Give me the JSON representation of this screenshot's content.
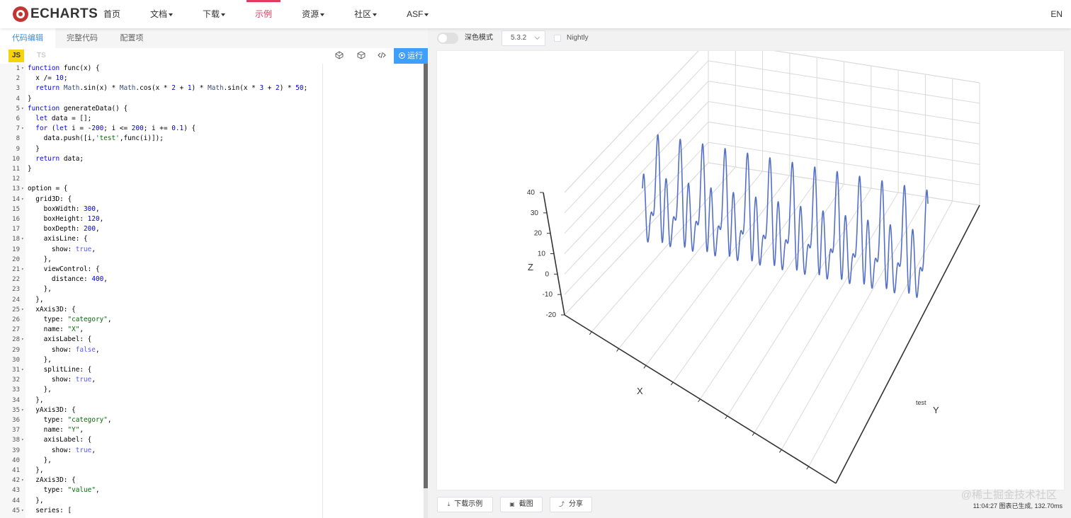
{
  "nav": {
    "logo_text": "ECHARTS",
    "items": [
      {
        "label": "首页",
        "dropdown": false,
        "active": false
      },
      {
        "label": "文档",
        "dropdown": true,
        "active": false
      },
      {
        "label": "下载",
        "dropdown": true,
        "active": false
      },
      {
        "label": "示例",
        "dropdown": false,
        "active": true
      },
      {
        "label": "资源",
        "dropdown": true,
        "active": false
      },
      {
        "label": "社区",
        "dropdown": true,
        "active": false
      },
      {
        "label": "ASF",
        "dropdown": true,
        "active": false
      }
    ],
    "lang": "EN",
    "accent": "#e43961"
  },
  "editor": {
    "tabs": [
      "代码编辑",
      "完整代码",
      "配置项"
    ],
    "active_tab": 0,
    "lang_js": "JS",
    "lang_ts": "TS",
    "tool_icons": [
      "codepen-icon",
      "codesandbox-icon",
      "code-icon"
    ],
    "run_label": "运行",
    "lines": [
      [
        {
          "t": "function ",
          "c": "kw"
        },
        {
          "t": "func(x) {",
          "c": ""
        }
      ],
      [
        {
          "t": "  x /= ",
          "c": ""
        },
        {
          "t": "10",
          "c": "num"
        },
        {
          "t": ";",
          "c": ""
        }
      ],
      [
        {
          "t": "  ",
          "c": ""
        },
        {
          "t": "return ",
          "c": "kw"
        },
        {
          "t": "Math",
          "c": "fn"
        },
        {
          "t": ".sin(x) * ",
          "c": ""
        },
        {
          "t": "Math",
          "c": "fn"
        },
        {
          "t": ".cos(x * ",
          "c": ""
        },
        {
          "t": "2",
          "c": "num"
        },
        {
          "t": " + ",
          "c": ""
        },
        {
          "t": "1",
          "c": "num"
        },
        {
          "t": ") * ",
          "c": ""
        },
        {
          "t": "Math",
          "c": "fn"
        },
        {
          "t": ".sin(x * ",
          "c": ""
        },
        {
          "t": "3",
          "c": "num"
        },
        {
          "t": " + ",
          "c": ""
        },
        {
          "t": "2",
          "c": "num"
        },
        {
          "t": ") * ",
          "c": ""
        },
        {
          "t": "50",
          "c": "num"
        },
        {
          "t": ";",
          "c": ""
        }
      ],
      [
        {
          "t": "}",
          "c": ""
        }
      ],
      [
        {
          "t": "function ",
          "c": "kw"
        },
        {
          "t": "generateData() {",
          "c": ""
        }
      ],
      [
        {
          "t": "  ",
          "c": ""
        },
        {
          "t": "let ",
          "c": "kw"
        },
        {
          "t": "data = [];",
          "c": ""
        }
      ],
      [
        {
          "t": "  ",
          "c": ""
        },
        {
          "t": "for ",
          "c": "kw"
        },
        {
          "t": "(",
          "c": ""
        },
        {
          "t": "let ",
          "c": "kw"
        },
        {
          "t": "i = -",
          "c": ""
        },
        {
          "t": "200",
          "c": "num"
        },
        {
          "t": "; i <= ",
          "c": ""
        },
        {
          "t": "200",
          "c": "num"
        },
        {
          "t": "; i += ",
          "c": ""
        },
        {
          "t": "0.1",
          "c": "num"
        },
        {
          "t": ") {",
          "c": ""
        }
      ],
      [
        {
          "t": "    data.push([i,",
          "c": ""
        },
        {
          "t": "'test'",
          "c": "str"
        },
        {
          "t": ",func(i)]);",
          "c": ""
        }
      ],
      [
        {
          "t": "  }",
          "c": ""
        }
      ],
      [
        {
          "t": "  ",
          "c": ""
        },
        {
          "t": "return ",
          "c": "kw"
        },
        {
          "t": "data;",
          "c": ""
        }
      ],
      [
        {
          "t": "}",
          "c": ""
        }
      ],
      [
        {
          "t": "",
          "c": ""
        }
      ],
      [
        {
          "t": "option = {",
          "c": ""
        }
      ],
      [
        {
          "t": "  grid3D: {",
          "c": ""
        }
      ],
      [
        {
          "t": "    boxWidth: ",
          "c": ""
        },
        {
          "t": "300",
          "c": "num"
        },
        {
          "t": ",",
          "c": ""
        }
      ],
      [
        {
          "t": "    boxHeight: ",
          "c": ""
        },
        {
          "t": "120",
          "c": "num"
        },
        {
          "t": ",",
          "c": ""
        }
      ],
      [
        {
          "t": "    boxDepth: ",
          "c": ""
        },
        {
          "t": "200",
          "c": "num"
        },
        {
          "t": ",",
          "c": ""
        }
      ],
      [
        {
          "t": "    axisLine: {",
          "c": ""
        }
      ],
      [
        {
          "t": "      show: ",
          "c": ""
        },
        {
          "t": "true",
          "c": "bool"
        },
        {
          "t": ",",
          "c": ""
        }
      ],
      [
        {
          "t": "    },",
          "c": ""
        }
      ],
      [
        {
          "t": "    viewControl: {",
          "c": ""
        }
      ],
      [
        {
          "t": "      distance: ",
          "c": ""
        },
        {
          "t": "400",
          "c": "num"
        },
        {
          "t": ",",
          "c": ""
        }
      ],
      [
        {
          "t": "    },",
          "c": ""
        }
      ],
      [
        {
          "t": "  },",
          "c": ""
        }
      ],
      [
        {
          "t": "  xAxis3D: {",
          "c": ""
        }
      ],
      [
        {
          "t": "    type: ",
          "c": ""
        },
        {
          "t": "\"category\"",
          "c": "str"
        },
        {
          "t": ",",
          "c": ""
        }
      ],
      [
        {
          "t": "    name: ",
          "c": ""
        },
        {
          "t": "\"X\"",
          "c": "str"
        },
        {
          "t": ",",
          "c": ""
        }
      ],
      [
        {
          "t": "    axisLabel: {",
          "c": ""
        }
      ],
      [
        {
          "t": "      show: ",
          "c": ""
        },
        {
          "t": "false",
          "c": "bool"
        },
        {
          "t": ",",
          "c": ""
        }
      ],
      [
        {
          "t": "    },",
          "c": ""
        }
      ],
      [
        {
          "t": "    splitLine: {",
          "c": ""
        }
      ],
      [
        {
          "t": "      show: ",
          "c": ""
        },
        {
          "t": "true",
          "c": "bool"
        },
        {
          "t": ",",
          "c": ""
        }
      ],
      [
        {
          "t": "    },",
          "c": ""
        }
      ],
      [
        {
          "t": "  },",
          "c": ""
        }
      ],
      [
        {
          "t": "  yAxis3D: {",
          "c": ""
        }
      ],
      [
        {
          "t": "    type: ",
          "c": ""
        },
        {
          "t": "\"category\"",
          "c": "str"
        },
        {
          "t": ",",
          "c": ""
        }
      ],
      [
        {
          "t": "    name: ",
          "c": ""
        },
        {
          "t": "\"Y\"",
          "c": "str"
        },
        {
          "t": ",",
          "c": ""
        }
      ],
      [
        {
          "t": "    axisLabel: {",
          "c": ""
        }
      ],
      [
        {
          "t": "      show: ",
          "c": ""
        },
        {
          "t": "true",
          "c": "bool"
        },
        {
          "t": ",",
          "c": ""
        }
      ],
      [
        {
          "t": "    },",
          "c": ""
        }
      ],
      [
        {
          "t": "  },",
          "c": ""
        }
      ],
      [
        {
          "t": "  zAxis3D: {",
          "c": ""
        }
      ],
      [
        {
          "t": "    type: ",
          "c": ""
        },
        {
          "t": "\"value\"",
          "c": "str"
        },
        {
          "t": ",",
          "c": ""
        }
      ],
      [
        {
          "t": "  },",
          "c": ""
        }
      ],
      [
        {
          "t": "  series: [",
          "c": ""
        }
      ]
    ],
    "fold_lines": [
      1,
      5,
      7,
      13,
      14,
      18,
      21,
      25,
      28,
      31,
      35,
      38,
      42,
      45
    ]
  },
  "preview": {
    "dark_mode_label": "深色模式",
    "version": "5.3.2",
    "nightly_label": "Nightly",
    "buttons": [
      {
        "label": "下载示例",
        "icon": "download-icon"
      },
      {
        "label": "截图",
        "icon": "camera-icon"
      },
      {
        "label": "分享",
        "icon": "share-icon"
      }
    ],
    "status": "11:04:27  图表已生成, 132.70ms",
    "watermark": "@稀土掘金技术社区"
  },
  "chart_data": {
    "type": "line3D",
    "x_axis": {
      "name": "X",
      "type": "category",
      "labels_shown": false
    },
    "y_axis": {
      "name": "Y",
      "type": "category",
      "categories": [
        "test"
      ]
    },
    "z_axis": {
      "name": "Z",
      "type": "value",
      "ticks": [
        -20,
        -10,
        0,
        10,
        20,
        30,
        40
      ]
    },
    "series": [
      {
        "x_range": [
          -200,
          200
        ],
        "step": 0.1,
        "y": "test",
        "formula": "sin(x/10)*cos(x/10*2+1)*sin(x/10*3+2)*50",
        "color": "#5470c6"
      }
    ],
    "grid": true
  }
}
